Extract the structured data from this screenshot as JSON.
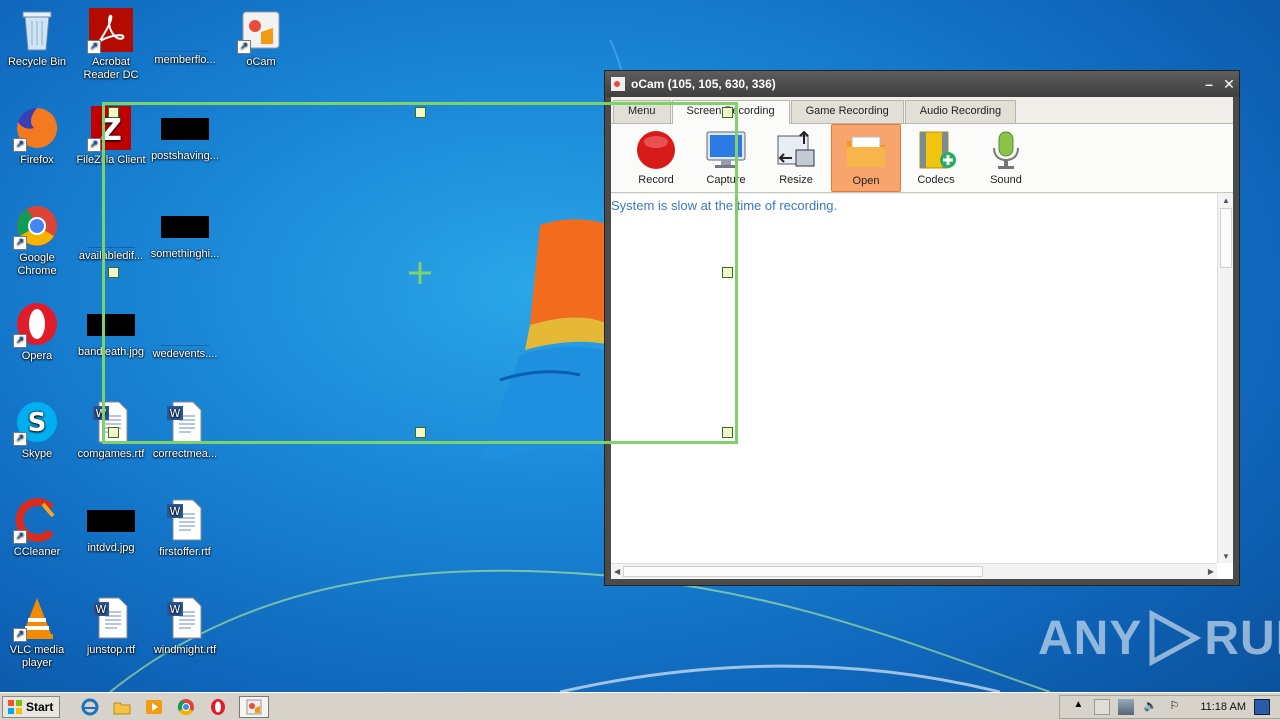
{
  "desktop": {
    "icons": [
      {
        "label": "Recycle Bin",
        "icon": "recycle-bin-icon"
      },
      {
        "label": "Acrobat Reader DC",
        "icon": "acrobat-icon"
      },
      {
        "label": "memberflo...",
        "icon": "blank-file-icon"
      },
      {
        "label": "oCam",
        "icon": "ocam-icon"
      },
      {
        "label": "Firefox",
        "icon": "firefox-icon"
      },
      {
        "label": "FileZilla Client",
        "icon": "filezilla-icon"
      },
      {
        "label": "postshaving...",
        "icon": "black-image-icon"
      },
      {
        "label": "Google Chrome",
        "icon": "chrome-icon"
      },
      {
        "label": "availabledif...",
        "icon": "blank-file-icon"
      },
      {
        "label": "somethinghi...",
        "icon": "black-image-icon"
      },
      {
        "label": "Opera",
        "icon": "opera-icon"
      },
      {
        "label": "bandleath.jpg",
        "icon": "black-image-icon"
      },
      {
        "label": "wedevents....",
        "icon": "blank-file-icon"
      },
      {
        "label": "Skype",
        "icon": "skype-icon"
      },
      {
        "label": "comgames.rtf",
        "icon": "word-doc-icon"
      },
      {
        "label": "correctmea...",
        "icon": "word-doc-icon"
      },
      {
        "label": "CCleaner",
        "icon": "ccleaner-icon"
      },
      {
        "label": "intdvd.jpg",
        "icon": "black-image-icon"
      },
      {
        "label": "firstoffer.rtf",
        "icon": "word-doc-icon"
      },
      {
        "label": "VLC media player",
        "icon": "vlc-icon"
      },
      {
        "label": "junstop.rtf",
        "icon": "word-doc-icon"
      },
      {
        "label": "windmight.rtf",
        "icon": "word-doc-icon"
      }
    ]
  },
  "ocam": {
    "title": "oCam (105, 105, 630, 336)",
    "minimize_label": "–",
    "close_label": "✕",
    "tabs": [
      "Menu",
      "Screen Recording",
      "Game Recording",
      "Audio Recording"
    ],
    "active_tab": "Screen Recording",
    "tools": [
      {
        "label": "Record",
        "icon": "record-icon"
      },
      {
        "label": "Capture",
        "icon": "capture-monitor-icon"
      },
      {
        "label": "Resize",
        "icon": "resize-icon"
      },
      {
        "label": "Open",
        "icon": "folder-open-icon"
      },
      {
        "label": "Codecs",
        "icon": "codecs-film-icon"
      },
      {
        "label": "Sound",
        "icon": "microphone-icon"
      }
    ],
    "active_tool": "Open",
    "log_message": "System is slow at the time of recording."
  },
  "watermark": {
    "text_left": "ANY",
    "text_right": "RUN"
  },
  "taskbar": {
    "start_label": "Start",
    "pinned": [
      "ie-icon",
      "explorer-icon",
      "media-player-icon",
      "chrome-icon",
      "opera-icon",
      "ocam-icon"
    ],
    "clock": "11:18 AM"
  },
  "colors": {
    "record_frame": "#7fd16a",
    "log_text": "#3a78c2",
    "active_tool_bg": "#f7a46d"
  }
}
